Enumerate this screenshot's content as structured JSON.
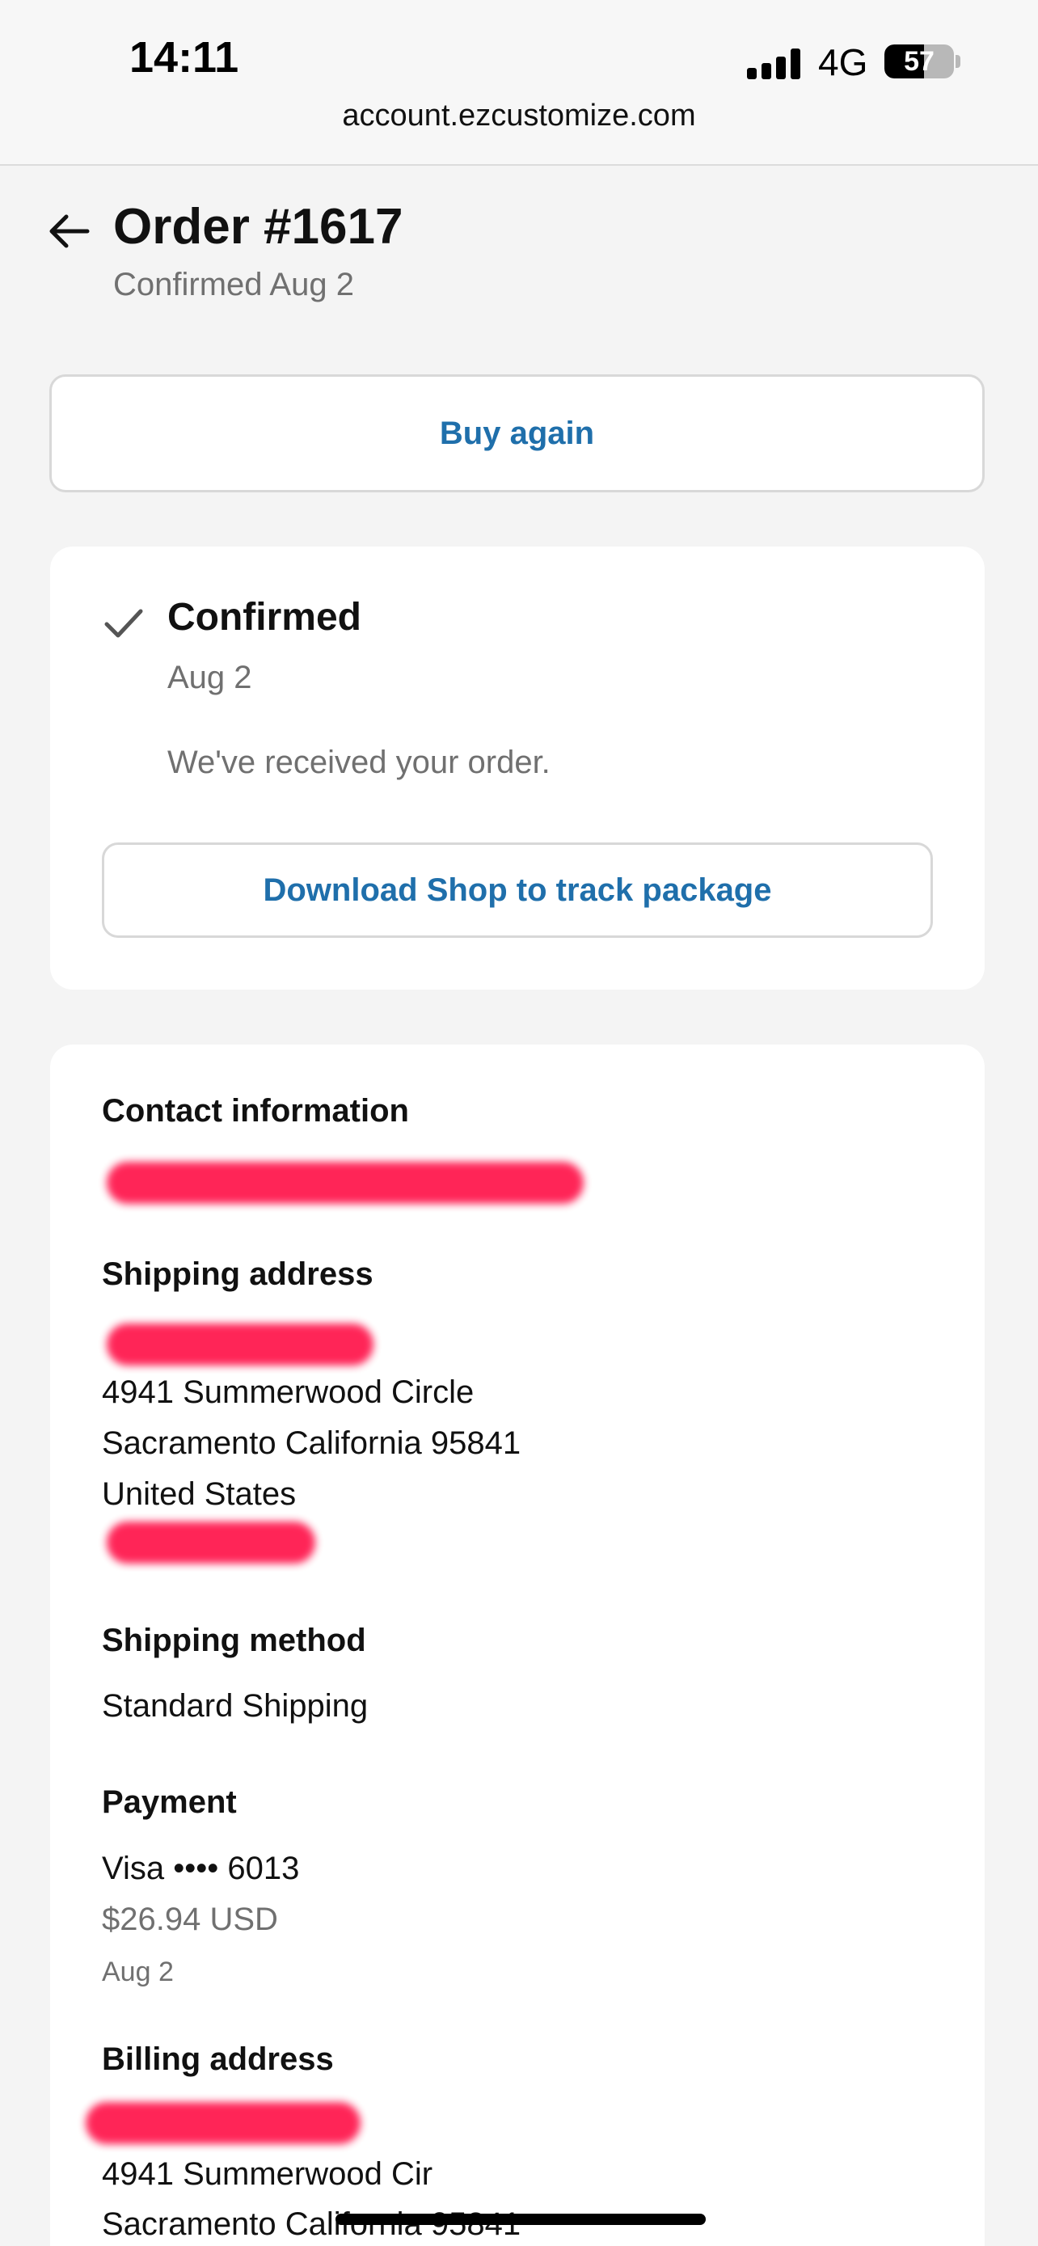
{
  "status_bar": {
    "time": "14:11",
    "network": "4G",
    "battery": "57",
    "battery_level": 0.57
  },
  "browser": {
    "url": "account.ezcustomize.com"
  },
  "header": {
    "back_icon": "arrow-left-icon",
    "title": "Order #1617",
    "subtitle": "Confirmed Aug 2"
  },
  "actions": {
    "buy_again": "Buy again",
    "track_package": "Download Shop to track package"
  },
  "status": {
    "icon": "checkmark-icon",
    "title": "Confirmed",
    "date": "Aug 2",
    "message": "We've received your order."
  },
  "details": {
    "contact_title": "Contact information",
    "shipping_title": "Shipping address",
    "shipping_lines": [
      "4941 Summerwood Circle",
      "Sacramento California 95841",
      "United States"
    ],
    "shipping_method_title": "Shipping method",
    "shipping_method": "Standard Shipping",
    "payment_title": "Payment",
    "payment_card": "Visa •••• 6013",
    "payment_amount": "$26.94 USD",
    "payment_date": "Aug 2",
    "billing_title": "Billing address",
    "billing_lines": [
      "4941 Summerwood Cir",
      "Sacramento California 95841"
    ]
  },
  "colors": {
    "accent": "#1f6fab",
    "redaction": "#ff1a4f",
    "background": "#f4f4f4"
  }
}
